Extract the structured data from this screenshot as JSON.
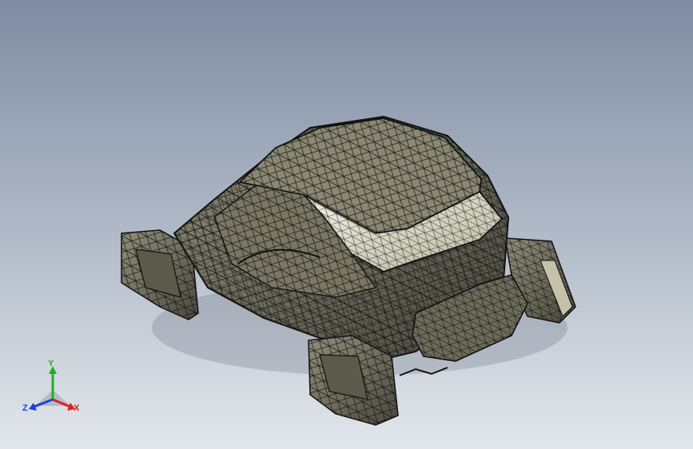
{
  "viewport": {
    "background_top": "#7f8ba1",
    "background_bottom": "#e3e7ec",
    "model_fill": "#a9a791",
    "mesh_color": "#111111"
  },
  "triad": {
    "x_label": "X",
    "y_label": "Y",
    "z_label": "Z",
    "x_color": "#e02020",
    "y_color": "#20b020",
    "z_color": "#2040e0"
  }
}
